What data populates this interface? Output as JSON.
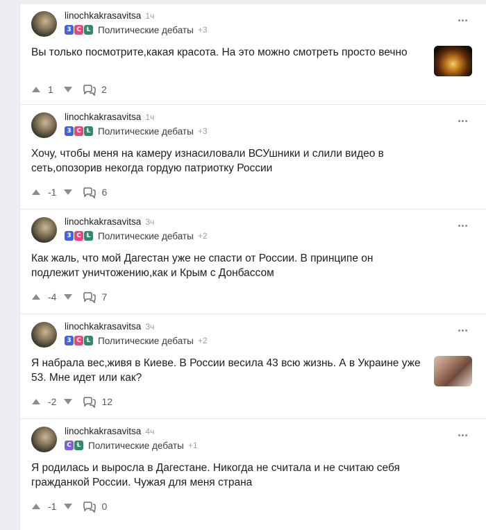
{
  "posts": [
    {
      "author": "linochkakrasavitsa",
      "time": "1ч",
      "badges": [
        "3",
        "С",
        "Ɫ"
      ],
      "community": "Политические дебаты",
      "extra": "+3",
      "text": "Вы только посмотрите,какая красота. На это можно смотреть просто вечно",
      "score": "1",
      "comments": "2",
      "thumb": "night-city"
    },
    {
      "author": "linochkakrasavitsa",
      "time": "1ч",
      "badges": [
        "3",
        "С",
        "Ɫ"
      ],
      "community": "Политические дебаты",
      "extra": "+3",
      "text": "Хочу, чтобы меня на камеру изнасиловали ВСУшники и слили видео в сеть,опозорив некогда гордую патриотку России",
      "score": "-1",
      "comments": "6"
    },
    {
      "author": "linochkakrasavitsa",
      "time": "3ч",
      "badges": [
        "3",
        "С",
        "Ɫ"
      ],
      "community": "Политические дебаты",
      "extra": "+2",
      "text": "Как жаль, что мой Дагестан уже не спасти от России. В принципе он подлежит уничтожению,как и Крым с Донбассом",
      "score": "-4",
      "comments": "7"
    },
    {
      "author": "linochkakrasavitsa",
      "time": "3ч",
      "badges": [
        "3",
        "С",
        "Ɫ"
      ],
      "community": "Политические дебаты",
      "extra": "+2",
      "text": "Я набрала вес,живя в Киеве. В России весила 43 всю жизнь. А в Украине уже 53. Мне идет или как?",
      "score": "-2",
      "comments": "12",
      "thumb": "person-photo"
    },
    {
      "author": "linochkakrasavitsa",
      "time": "4ч",
      "badges": [
        "С",
        "Ɫ"
      ],
      "community": "Политические дебаты",
      "extra": "+1",
      "text": "Я родилась и выросла в Дагестане. Никогда не считала и не считаю себя гражданкой России. Чужая для меня страна",
      "score": "-1",
      "comments": "0"
    }
  ],
  "icons": {
    "upvote": "upvote-arrow-icon",
    "downvote": "downvote-arrow-icon",
    "comments": "comment-bubbles-icon",
    "more": "more-dots-icon"
  },
  "colors": {
    "background": "#eceef1",
    "card": "#ffffff",
    "muted": "#9aa0a6"
  }
}
